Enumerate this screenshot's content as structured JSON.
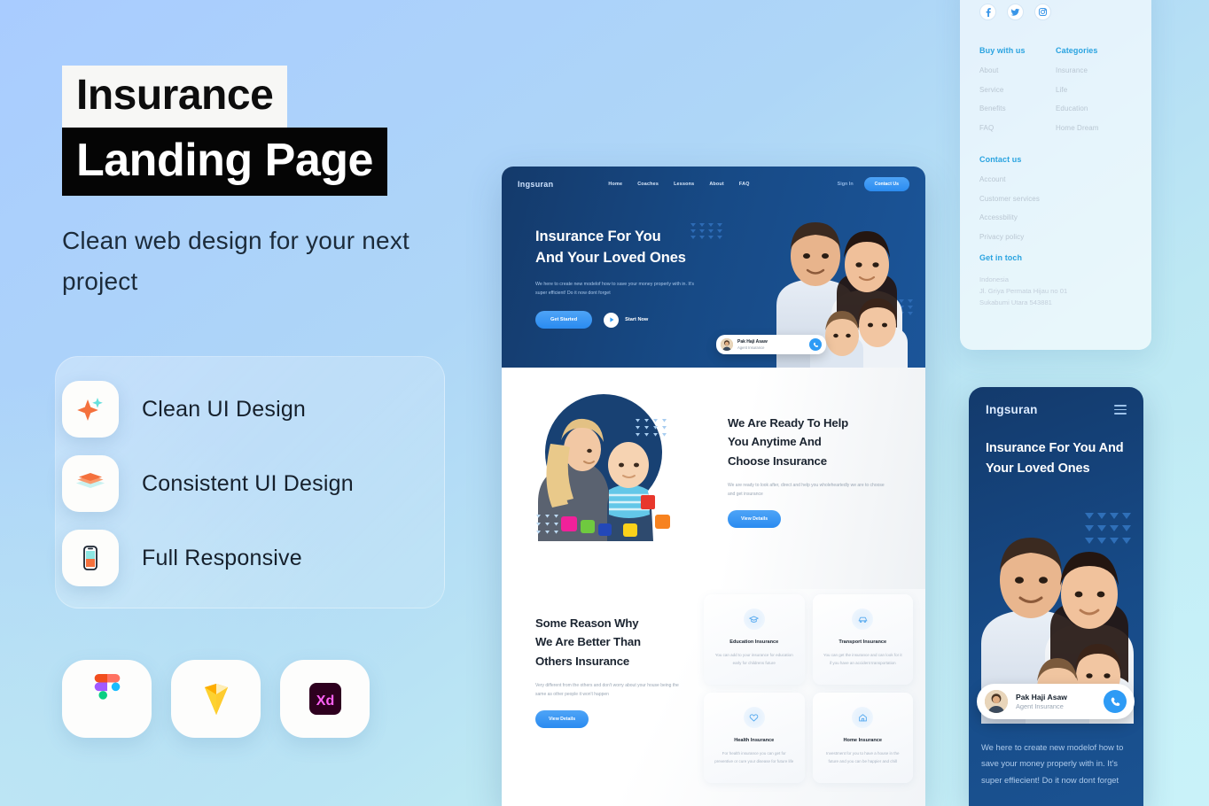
{
  "promo": {
    "title_line1": "Insurance",
    "title_line2": "Landing Page",
    "subtitle": "Clean web design for your next project"
  },
  "features": [
    {
      "label": "Clean UI Design",
      "icon": "sparkle-icon"
    },
    {
      "label": "Consistent UI Design",
      "icon": "layers-icon"
    },
    {
      "label": "Full Responsive",
      "icon": "mobile-icon"
    }
  ],
  "apps": [
    {
      "name": "figma-icon",
      "label": "Figma"
    },
    {
      "name": "sketch-icon",
      "label": "Sketch"
    },
    {
      "name": "adobe-xd-icon",
      "label": "Xd"
    }
  ],
  "desktop": {
    "brand": "Ingsuran",
    "nav": [
      "Home",
      "Coaches",
      "Lessons",
      "About",
      "FAQ"
    ],
    "sign_in": "Sign In",
    "contact_btn": "Contact Us",
    "hero": {
      "heading_line1": "Insurance For You",
      "heading_line2": "And Your Loved Ones",
      "paragraph": "We here to create new modelof how to save your money properly with in. It's super efficient! Do it now dont forget",
      "primary_btn": "Get Started",
      "play_label": "Start Now"
    },
    "agent_card": {
      "name": "Pak Haji Asaw",
      "role": "Agent Insurance"
    },
    "section2": {
      "heading_line1": "We Are Ready To Help",
      "heading_line2": "You Anytime And",
      "heading_line3": "Choose Insurance",
      "paragraph": "We are ready to look after, direct and help you wholeheartedly we are to choose and get insurance",
      "btn": "View Details"
    },
    "section3": {
      "heading_line1": "Some Reason Why",
      "heading_line2": "We Are Better Than",
      "heading_line3": "Others Insurance",
      "paragraph": "Very different from the others and don't worry about your house being the same as other people it won't happen",
      "btn": "View Details",
      "cards": [
        {
          "icon": "graduation-cap-icon",
          "title": "Education Insurance",
          "desc": "You can add to your insurance for education early for childrens future"
        },
        {
          "icon": "car-icon",
          "title": "Transport Insurance",
          "desc": "You can get the insurance and can look for it if you have an accident transportation"
        },
        {
          "icon": "heart-icon",
          "title": "Health Insurance",
          "desc": "For health insurance you can get for preventive or cure your disease for future life"
        },
        {
          "icon": "home-icon",
          "title": "Home Insurance",
          "desc": "Investment for you to have a house in the future and you can be happier and chill"
        }
      ]
    }
  },
  "footer": {
    "socials": [
      "facebook-icon",
      "twitter-icon",
      "instagram-icon"
    ],
    "columns": [
      {
        "heading": "Buy with us",
        "links": [
          "About",
          "Service",
          "Benefits",
          "FAQ"
        ]
      },
      {
        "heading": "Categories",
        "links": [
          "Insurance",
          "Life",
          "Education",
          "Home Dream"
        ]
      }
    ],
    "contact": {
      "heading": "Contact us",
      "links": [
        "Account",
        "Customer services",
        "Accessbility",
        "Privacy policy"
      ]
    },
    "get_in_touch": {
      "heading": "Get in toch",
      "address_line1": "Indonesia",
      "address_line2": "Jl. Griya Permata Hijau no 01",
      "address_line3": "Sukabumi Utara 543881"
    }
  },
  "mobile": {
    "brand": "Ingsuran",
    "menu_icon": "hamburger-icon",
    "heading_line1": "Insurance For You And",
    "heading_line2": "Your Loved Ones",
    "agent_card": {
      "name": "Pak Haji Asaw",
      "role": "Agent Insurance",
      "call_icon": "phone-icon"
    },
    "paragraph": "We here to create new modelof how to save your money properly with in. It's super effiecient! Do it now dont forget"
  },
  "colors": {
    "brand_blue": "#2e9bf5",
    "deep_navy": "#143a6b",
    "accent_orange": "#f4713d",
    "footer_heading": "#29a3e0",
    "bg_top_left": "#a9ccff",
    "bg_bottom_right": "#c6f0f8"
  }
}
